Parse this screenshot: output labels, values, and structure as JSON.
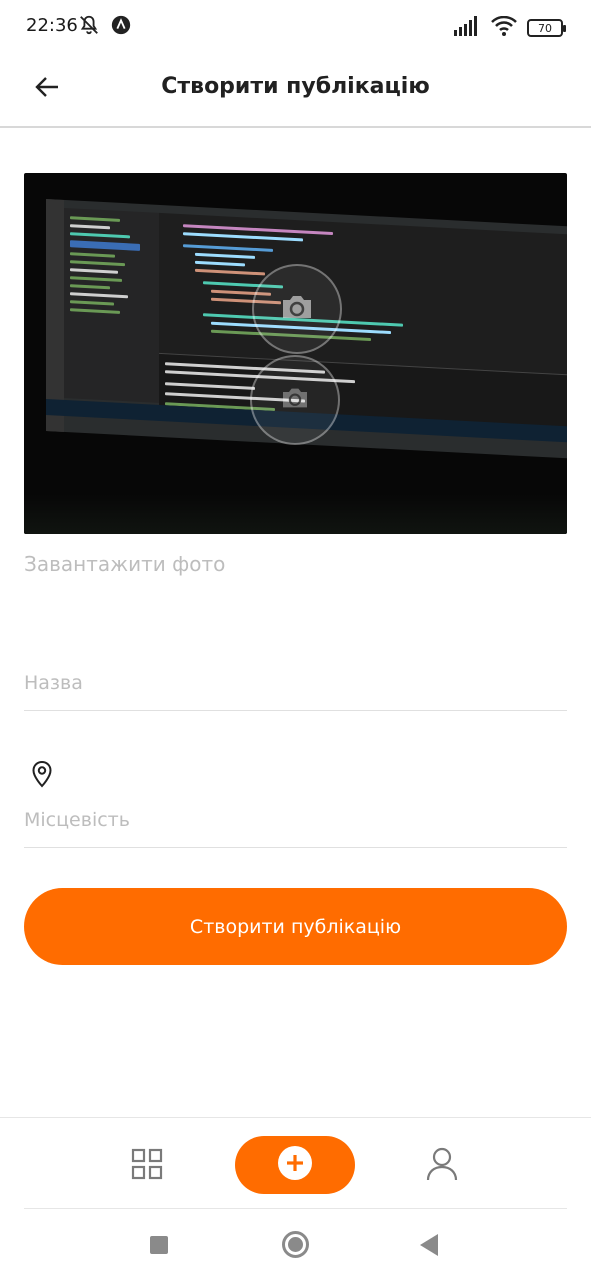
{
  "status_bar": {
    "time": "22:36",
    "battery": "70",
    "icons": [
      "bell-off-icon",
      "notification-app-icon",
      "signal-icon",
      "wifi-icon",
      "battery-icon"
    ]
  },
  "header": {
    "title": "Створити публікацію",
    "back_icon": "arrow-left-icon"
  },
  "photo": {
    "overlay_icon": "camera-icon"
  },
  "upload": {
    "label": "Завантажити фото"
  },
  "form": {
    "name_placeholder": "Назва",
    "location_placeholder": "Місцевість",
    "location_icon": "map-pin-icon"
  },
  "submit": {
    "label": "Створити публікацію"
  },
  "tab_bar": {
    "items": [
      "grid-icon",
      "plus-icon",
      "user-icon"
    ]
  },
  "colors": {
    "accent": "#FF6C00",
    "placeholder": "#BDBDBD",
    "divider": "#E0E0E0"
  }
}
